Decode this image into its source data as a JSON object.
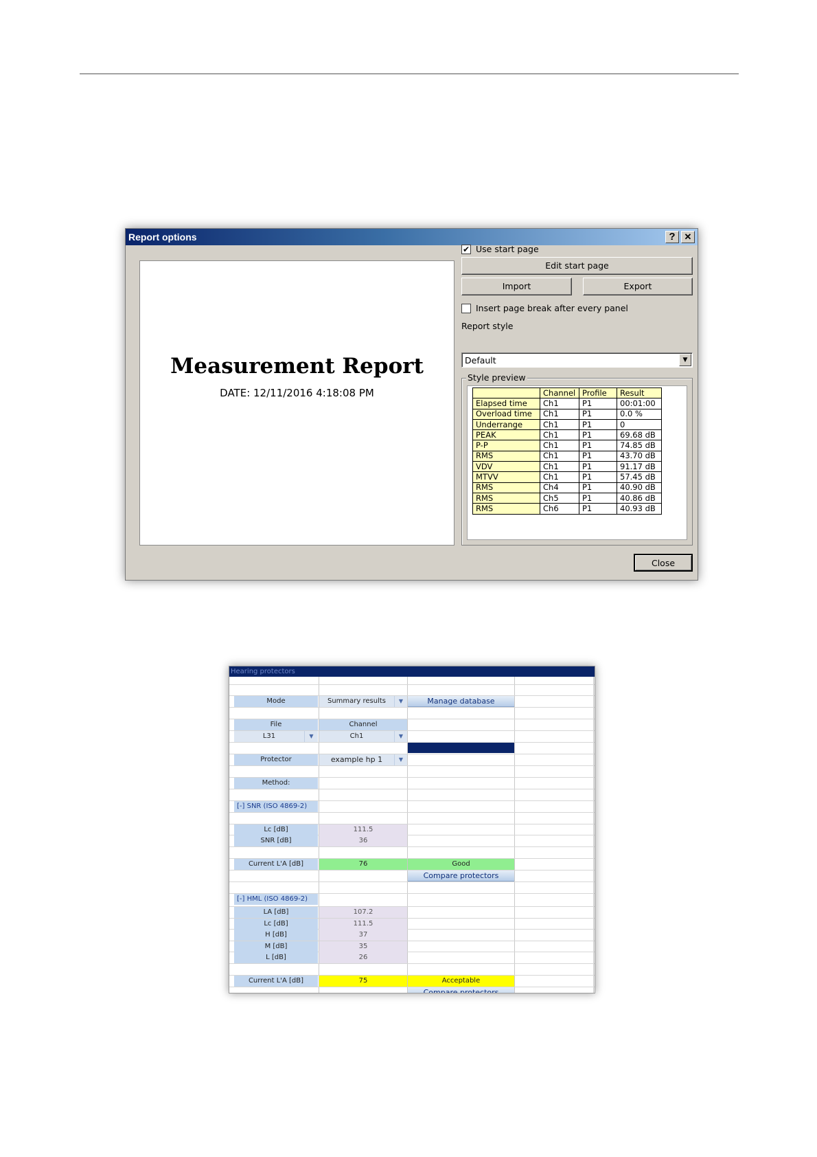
{
  "dialog": {
    "title": "Report options",
    "help_btn": "?",
    "close_btn": "✕",
    "preview": {
      "title": "Measurement Report",
      "date": "DATE: 12/11/2016 4:18:08 PM"
    },
    "use_start_page": {
      "label": "Use start page",
      "checked": true,
      "mark": "✔"
    },
    "edit_start_page": "Edit start page",
    "import": "Import",
    "export": "Export",
    "page_break": {
      "label": "Insert page break after every panel",
      "checked": false
    },
    "report_style_label": "Report style",
    "report_style_value": "Default",
    "dropdown_arrow": "▼",
    "style_preview_label": "Style preview",
    "style_table": {
      "headers": [
        "",
        "Channel",
        "Profile",
        "Result"
      ],
      "rows": [
        [
          "Elapsed time",
          "Ch1",
          "P1",
          "00:01:00"
        ],
        [
          "Overload time",
          "Ch1",
          "P1",
          "0.0 %"
        ],
        [
          "Underrange",
          "Ch1",
          "P1",
          "0"
        ],
        [
          "PEAK",
          "Ch1",
          "P1",
          "69.68 dB"
        ],
        [
          "P-P",
          "Ch1",
          "P1",
          "74.85 dB"
        ],
        [
          "RMS",
          "Ch1",
          "P1",
          "43.70 dB"
        ],
        [
          "VDV",
          "Ch1",
          "P1",
          "91.17 dB"
        ],
        [
          "MTVV",
          "Ch1",
          "P1",
          "57.45 dB"
        ],
        [
          "RMS",
          "Ch4",
          "P1",
          "40.90 dB"
        ],
        [
          "RMS",
          "Ch5",
          "P1",
          "40.86 dB"
        ],
        [
          "RMS",
          "Ch6",
          "P1",
          "40.93 dB"
        ]
      ]
    },
    "close_button": "Close"
  },
  "hp": {
    "title": "Hearing protectors",
    "mode_label": "Mode",
    "mode_value": "Summary results",
    "manage_db": "Manage database",
    "file_label": "File",
    "channel_label": "Channel",
    "file_value": "L31",
    "channel_value": "Ch1",
    "dd_arrow": "▼",
    "protector_label": "Protector",
    "protector_value": "example hp 1",
    "method_label": "Method:",
    "snr_header": "[-]  SNR (ISO 4869-2)",
    "lc_label": "Lc [dB]",
    "lc_value": "111.5",
    "snr_label": "SNR [dB]",
    "snr_value": "36",
    "current_snr_label": "Current L'A [dB]",
    "current_snr_value": "76",
    "current_snr_rating": "Good",
    "compare_1": "Compare protectors",
    "hml_header": "[-]  HML (ISO 4869-2)",
    "la_label": "LA [dB]",
    "la_value": "107.2",
    "lc2_label": "Lc [dB]",
    "lc2_value": "111.5",
    "h_label": "H [dB]",
    "h_value": "37",
    "m_label": "M [dB]",
    "m_value": "35",
    "l_label": "L [dB]",
    "l_value": "26",
    "current_hml_label": "Current L'A [dB]",
    "current_hml_value": "75",
    "current_hml_rating": "Acceptable",
    "compare_2": "Compare protectors",
    "colors": {
      "good": "#90ee90",
      "acceptable": "#ffff00",
      "navy": "#0a2468"
    }
  }
}
